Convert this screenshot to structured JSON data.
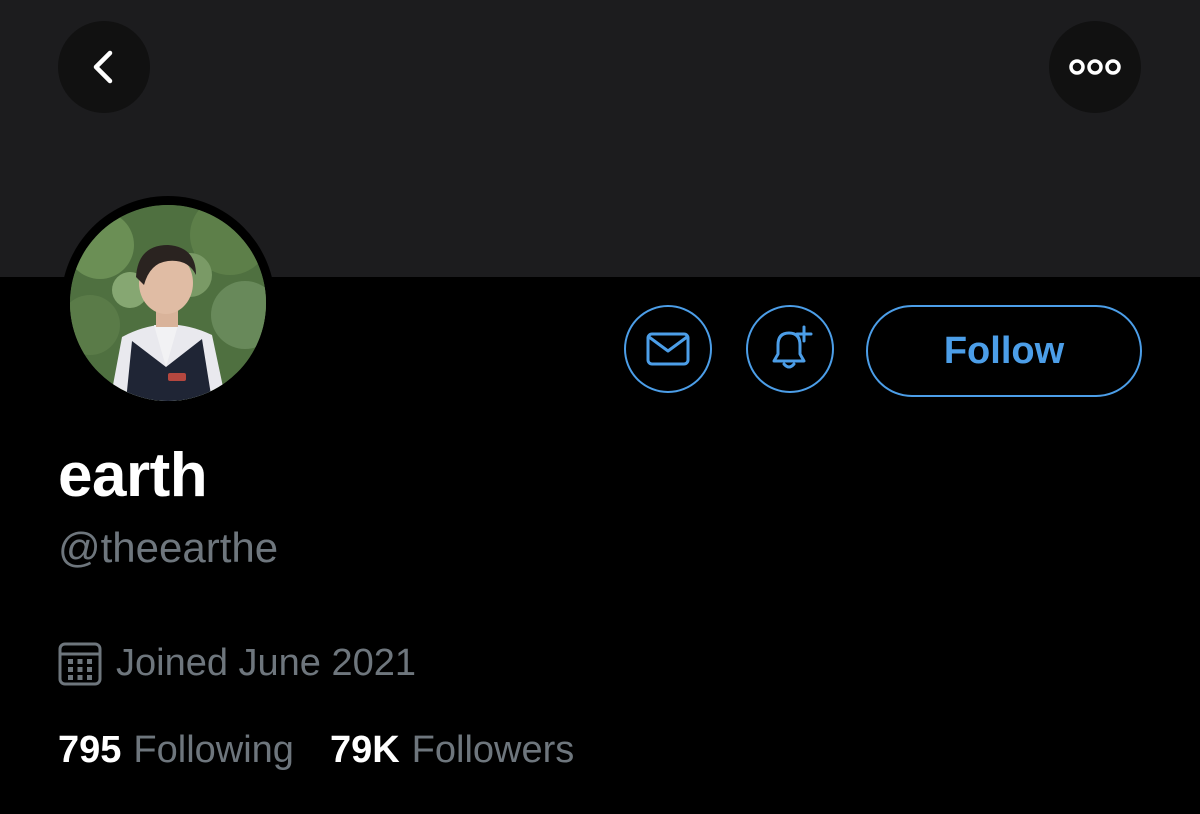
{
  "profile": {
    "display_name": "earth",
    "handle": "@theearthe",
    "joined": "Joined June 2021"
  },
  "stats": {
    "following_count": "795",
    "following_label": "Following",
    "followers_count": "79K",
    "followers_label": "Followers"
  },
  "actions": {
    "follow_label": "Follow"
  },
  "icons": {
    "back": "chevron-left-icon",
    "more": "more-options-icon",
    "message": "mail-icon",
    "notify": "bell-plus-icon",
    "calendar": "calendar-icon"
  },
  "colors": {
    "accent": "#4c9ee8",
    "background": "#000000",
    "banner": "#1c1c1e",
    "secondary_text": "#6e767d"
  }
}
